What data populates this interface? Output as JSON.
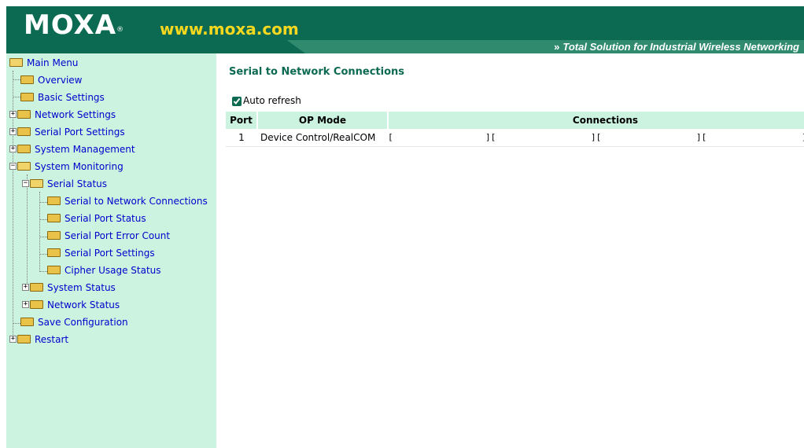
{
  "header": {
    "logo": "MOXA",
    "logo_mark": "®",
    "url": "www.moxa.com",
    "tagline_chevron": "»",
    "tagline": "Total Solution for Industrial Wireless Networking"
  },
  "sidebar": {
    "items": [
      {
        "label": "Main Menu"
      },
      {
        "label": "Overview"
      },
      {
        "label": "Basic Settings"
      },
      {
        "label": "Network Settings"
      },
      {
        "label": "Serial Port Settings"
      },
      {
        "label": "System Management"
      },
      {
        "label": "System Monitoring"
      },
      {
        "label": "Serial Status"
      },
      {
        "label": "Serial to Network Connections"
      },
      {
        "label": "Serial Port Status"
      },
      {
        "label": "Serial Port Error Count"
      },
      {
        "label": "Serial Port Settings"
      },
      {
        "label": "Cipher Usage Status"
      },
      {
        "label": "System Status"
      },
      {
        "label": "Network Status"
      },
      {
        "label": "Save Configuration"
      },
      {
        "label": "Restart"
      }
    ]
  },
  "main": {
    "title": "Serial to Network Connections",
    "auto_refresh_label": "Auto refresh",
    "auto_refresh_checked": true,
    "table": {
      "headers": [
        "Port",
        "OP Mode",
        "Connections"
      ],
      "rows": [
        {
          "port": "1",
          "op_mode": "Device Control/RealCOM",
          "connections": [
            "[",
            "][",
            "][",
            "][",
            "]"
          ]
        }
      ]
    }
  },
  "colors": {
    "brand_green": "#0d6a52",
    "sidebar_bg": "#ccf3e0",
    "link_blue": "#0000cc",
    "url_yellow": "#f6d81f"
  }
}
